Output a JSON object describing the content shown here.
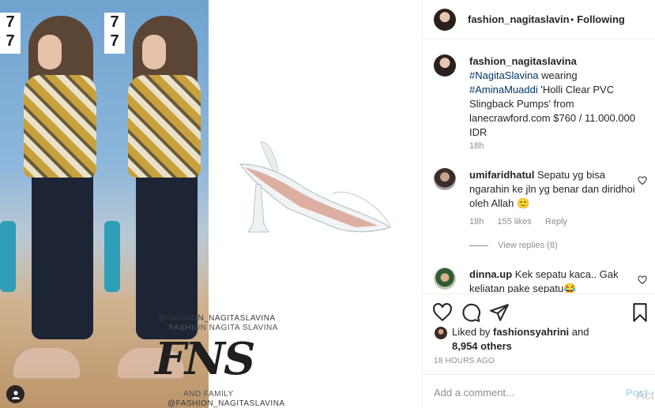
{
  "post": {
    "author": "fashion_nagitaslavina",
    "separator": "•",
    "follow_state": "Following"
  },
  "media": {
    "watermark": {
      "handle_top": "@FASHION_NAGITASLAVINA",
      "name": "FASHION NAGITA SLAVINA",
      "logo": "FNS",
      "family": "AND FAMILY",
      "handle_bottom": "@FASHION_NAGITASLAVINA"
    },
    "tv_logo": "7\n7",
    "tag_icon": "user-tag-icon"
  },
  "caption": {
    "username": "fashion_nagitaslavina",
    "tag1": "#NagitaSlavina",
    "text1": " wearing",
    "tag2": "#AminaMuaddi",
    "text2": " 'Holli Clear PVC Slingback Pumps' from lanecrawford.com $760 / 11.000.000 IDR",
    "time": "18h"
  },
  "comments": [
    {
      "username": "umifaridhatul",
      "text": " Sepatu yg bisa ngarahin ke jln yg benar dan diridhoi oleh Allah 🙂",
      "time": "18h",
      "likes": "155 likes",
      "reply": "Reply"
    },
    {
      "username": "dinna.up",
      "text": " Kek sepatu kaca.. Gak keliatan pake sepatu😂"
    }
  ],
  "view_replies": "View replies (8)",
  "actions": {
    "icons": [
      "heart-icon",
      "comment-icon",
      "share-icon",
      "bookmark-icon"
    ]
  },
  "likes": {
    "prefix": "Liked by ",
    "user": "fashionsyahrini",
    "mid": " and ",
    "others": "8,954 others"
  },
  "timestamp": "18 HOURS AGO",
  "add_comment": {
    "placeholder": "Add a comment...",
    "post_label": "Post",
    "os_ghost": "Act"
  },
  "colors": {
    "text": "#262626",
    "muted": "#8e8e8e",
    "link": "#00376b",
    "post_disabled": "#b2dffc",
    "border": "#efefef"
  }
}
